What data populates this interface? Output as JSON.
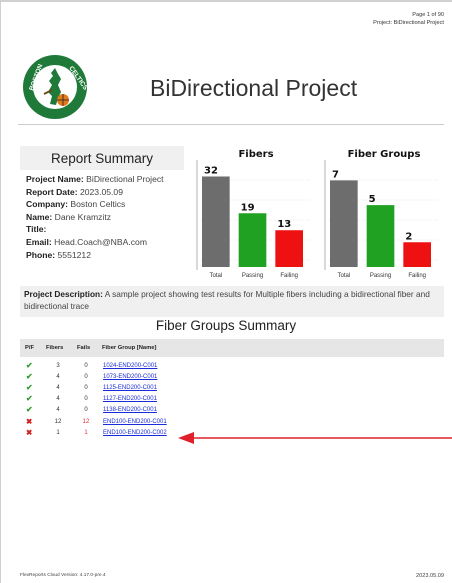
{
  "header": {
    "page_label": "Page 1 of 90",
    "project_label": "Project: BiDirectional Project"
  },
  "title": "BiDirectional Project",
  "report_summary": {
    "heading": "Report Summary",
    "lines": [
      {
        "label": "Project Name:",
        "value": "BiDirectional Project"
      },
      {
        "label": "Report Date:",
        "value": "2023.05.09"
      },
      {
        "label": "Company:",
        "value": "Boston Celtics"
      },
      {
        "label": "Name:",
        "value": "Dane Kramzitz"
      },
      {
        "label": "Title:",
        "value": ""
      },
      {
        "label": "Email:",
        "value": "Head.Coach@NBA.com"
      },
      {
        "label": "Phone:",
        "value": "5551212"
      }
    ]
  },
  "chart_data": [
    {
      "type": "bar",
      "title": "Fibers",
      "categories": [
        "Total",
        "Passing",
        "Failing"
      ],
      "values": [
        32,
        19,
        13
      ],
      "colors": [
        "#6d6d6d",
        "#21a121",
        "#ee1111"
      ],
      "ylim": [
        0,
        35
      ]
    },
    {
      "type": "bar",
      "title": "Fiber Groups",
      "categories": [
        "Total",
        "Passing",
        "Failing"
      ],
      "values": [
        7,
        5,
        2
      ],
      "colors": [
        "#6d6d6d",
        "#21a121",
        "#ee1111"
      ],
      "ylim": [
        0,
        8
      ]
    }
  ],
  "description": {
    "label": "Project Description:",
    "text": "A sample project showing test results for Multiple fibers including a bidirectional fiber and bidirectional trace"
  },
  "fiber_groups": {
    "heading": "Fiber Groups Summary",
    "columns": [
      "P/F",
      "Fibers",
      "Fails",
      "Fiber Group [Name]"
    ],
    "rows": [
      {
        "status": "pass",
        "fibers": "3",
        "fails": "0",
        "name": "1024-END200-C001"
      },
      {
        "status": "pass",
        "fibers": "4",
        "fails": "0",
        "name": "1073-END200-C001"
      },
      {
        "status": "pass",
        "fibers": "4",
        "fails": "0",
        "name": "1125-END200-C001"
      },
      {
        "status": "pass",
        "fibers": "4",
        "fails": "0",
        "name": "1127-END200-C001"
      },
      {
        "status": "pass",
        "fibers": "4",
        "fails": "0",
        "name": "1138-END200-C001"
      },
      {
        "status": "fail",
        "fibers": "12",
        "fails": "12",
        "name": "END100-END200-C001"
      },
      {
        "status": "fail",
        "fibers": "1",
        "fails": "1",
        "name": "END100-END200-C002"
      }
    ]
  },
  "footer": {
    "version": "FlexReports Cloud Version: 4.17.0-pre.4",
    "date": "2023.05.09"
  },
  "colors": {
    "pass": "#2e9e2e",
    "fail": "#d12020",
    "arrow": "#e0202a",
    "celtics_green": "#1f7a3a"
  },
  "logo": {
    "text": "BOSTON CELTICS"
  }
}
